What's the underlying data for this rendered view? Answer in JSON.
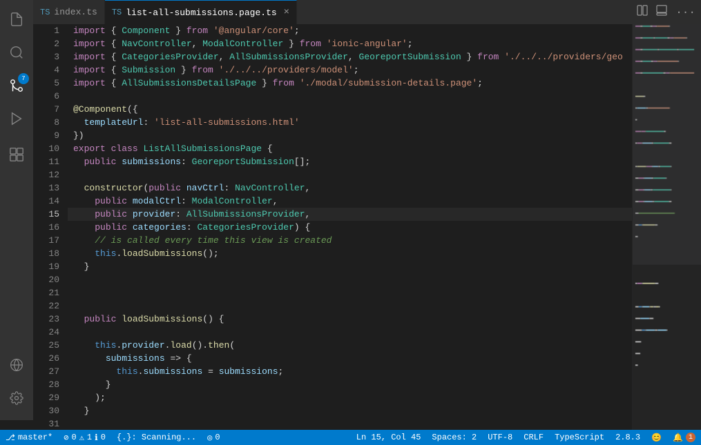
{
  "tabs": [
    {
      "id": "tab-index",
      "icon": "TS",
      "label": "index.ts",
      "active": false,
      "modified": false
    },
    {
      "id": "tab-list",
      "icon": "TS",
      "label": "list-all-submissions.page.ts",
      "active": true,
      "modified": false
    }
  ],
  "tabBarActions": [
    "copy-icon",
    "layout-icon",
    "more-icon"
  ],
  "lines": [
    {
      "num": 1,
      "tokens": [
        {
          "t": "kw",
          "v": "import"
        },
        {
          "t": "plain",
          "v": " { "
        },
        {
          "t": "cls",
          "v": "Component"
        },
        {
          "t": "plain",
          "v": " } "
        },
        {
          "t": "kw",
          "v": "from"
        },
        {
          "t": "plain",
          "v": " "
        },
        {
          "t": "str",
          "v": "'@angular/core'"
        },
        {
          "t": "plain",
          "v": ";"
        }
      ]
    },
    {
      "num": 2,
      "tokens": [
        {
          "t": "kw",
          "v": "import"
        },
        {
          "t": "plain",
          "v": " { "
        },
        {
          "t": "cls",
          "v": "NavController"
        },
        {
          "t": "plain",
          "v": ", "
        },
        {
          "t": "cls",
          "v": "ModalController"
        },
        {
          "t": "plain",
          "v": " } "
        },
        {
          "t": "kw",
          "v": "from"
        },
        {
          "t": "plain",
          "v": " "
        },
        {
          "t": "str",
          "v": "'ionic-angular'"
        },
        {
          "t": "plain",
          "v": ";"
        }
      ]
    },
    {
      "num": 3,
      "tokens": [
        {
          "t": "kw",
          "v": "import"
        },
        {
          "t": "plain",
          "v": " { "
        },
        {
          "t": "cls",
          "v": "CategoriesProvider"
        },
        {
          "t": "plain",
          "v": ", "
        },
        {
          "t": "cls",
          "v": "AllSubmissionsProvider"
        },
        {
          "t": "plain",
          "v": ", "
        },
        {
          "t": "cls",
          "v": "GeoreportSubmission"
        },
        {
          "t": "plain",
          "v": " } "
        },
        {
          "t": "kw",
          "v": "from"
        },
        {
          "t": "plain",
          "v": " "
        },
        {
          "t": "str",
          "v": "'./../../providers/geo"
        }
      ]
    },
    {
      "num": 4,
      "tokens": [
        {
          "t": "kw",
          "v": "import"
        },
        {
          "t": "plain",
          "v": " { "
        },
        {
          "t": "cls",
          "v": "Submission"
        },
        {
          "t": "plain",
          "v": " } "
        },
        {
          "t": "kw",
          "v": "from"
        },
        {
          "t": "plain",
          "v": " "
        },
        {
          "t": "str",
          "v": "'./../../providers/model'"
        },
        {
          "t": "plain",
          "v": ";"
        }
      ]
    },
    {
      "num": 5,
      "tokens": [
        {
          "t": "kw",
          "v": "import"
        },
        {
          "t": "plain",
          "v": " { "
        },
        {
          "t": "cls",
          "v": "AllSubmissionsDetailsPage"
        },
        {
          "t": "plain",
          "v": " } "
        },
        {
          "t": "kw",
          "v": "from"
        },
        {
          "t": "plain",
          "v": " "
        },
        {
          "t": "str",
          "v": "'./modal/submission-details.page'"
        },
        {
          "t": "plain",
          "v": ";"
        }
      ]
    },
    {
      "num": 6,
      "tokens": []
    },
    {
      "num": 7,
      "tokens": [
        {
          "t": "decorator",
          "v": "@Component"
        },
        {
          "t": "plain",
          "v": "({"
        }
      ]
    },
    {
      "num": 8,
      "tokens": [
        {
          "t": "plain",
          "v": "  "
        },
        {
          "t": "prop",
          "v": "templateUrl"
        },
        {
          "t": "plain",
          "v": ": "
        },
        {
          "t": "str",
          "v": "'list-all-submissions.html'"
        }
      ]
    },
    {
      "num": 9,
      "tokens": [
        {
          "t": "plain",
          "v": "})"
        }
      ]
    },
    {
      "num": 10,
      "tokens": [
        {
          "t": "kw",
          "v": "export"
        },
        {
          "t": "plain",
          "v": " "
        },
        {
          "t": "kw",
          "v": "class"
        },
        {
          "t": "plain",
          "v": " "
        },
        {
          "t": "cls",
          "v": "ListAllSubmissionsPage"
        },
        {
          "t": "plain",
          "v": " {"
        }
      ]
    },
    {
      "num": 11,
      "tokens": [
        {
          "t": "plain",
          "v": "  "
        },
        {
          "t": "kw",
          "v": "public"
        },
        {
          "t": "plain",
          "v": " "
        },
        {
          "t": "prop",
          "v": "submissions"
        },
        {
          "t": "plain",
          "v": ": "
        },
        {
          "t": "cls",
          "v": "GeoreportSubmission"
        },
        {
          "t": "plain",
          "v": "[];"
        }
      ]
    },
    {
      "num": 12,
      "tokens": []
    },
    {
      "num": 13,
      "tokens": [
        {
          "t": "plain",
          "v": "  "
        },
        {
          "t": "fn",
          "v": "constructor"
        },
        {
          "t": "plain",
          "v": "("
        },
        {
          "t": "kw",
          "v": "public"
        },
        {
          "t": "plain",
          "v": " "
        },
        {
          "t": "prop",
          "v": "navCtrl"
        },
        {
          "t": "plain",
          "v": ": "
        },
        {
          "t": "cls",
          "v": "NavController"
        },
        {
          "t": "plain",
          "v": ","
        }
      ]
    },
    {
      "num": 14,
      "tokens": [
        {
          "t": "plain",
          "v": "    "
        },
        {
          "t": "kw",
          "v": "public"
        },
        {
          "t": "plain",
          "v": " "
        },
        {
          "t": "prop",
          "v": "modalCtrl"
        },
        {
          "t": "plain",
          "v": ": "
        },
        {
          "t": "cls",
          "v": "ModalController"
        },
        {
          "t": "plain",
          "v": ","
        }
      ]
    },
    {
      "num": 15,
      "tokens": [
        {
          "t": "plain",
          "v": "    "
        },
        {
          "t": "kw",
          "v": "public"
        },
        {
          "t": "plain",
          "v": " "
        },
        {
          "t": "prop",
          "v": "provider"
        },
        {
          "t": "plain",
          "v": ": "
        },
        {
          "t": "cls",
          "v": "AllSubmissionsProvider"
        },
        {
          "t": "plain",
          "v": ","
        }
      ],
      "active": true
    },
    {
      "num": 16,
      "tokens": [
        {
          "t": "plain",
          "v": "    "
        },
        {
          "t": "kw",
          "v": "public"
        },
        {
          "t": "plain",
          "v": " "
        },
        {
          "t": "prop",
          "v": "categories"
        },
        {
          "t": "plain",
          "v": ": "
        },
        {
          "t": "cls",
          "v": "CategoriesProvider"
        },
        {
          "t": "plain",
          "v": ") {"
        }
      ]
    },
    {
      "num": 17,
      "tokens": [
        {
          "t": "plain",
          "v": "    "
        },
        {
          "t": "comment",
          "v": "// is called every time this view is created"
        }
      ]
    },
    {
      "num": 18,
      "tokens": [
        {
          "t": "plain",
          "v": "    "
        },
        {
          "t": "kw2",
          "v": "this"
        },
        {
          "t": "plain",
          "v": "."
        },
        {
          "t": "fn",
          "v": "loadSubmissions"
        },
        {
          "t": "plain",
          "v": "();"
        }
      ]
    },
    {
      "num": 19,
      "tokens": [
        {
          "t": "plain",
          "v": "  }"
        }
      ]
    },
    {
      "num": 20,
      "tokens": []
    },
    {
      "num": 21,
      "tokens": []
    },
    {
      "num": 22,
      "tokens": []
    },
    {
      "num": 23,
      "tokens": [
        {
          "t": "plain",
          "v": "  "
        },
        {
          "t": "kw",
          "v": "public"
        },
        {
          "t": "plain",
          "v": " "
        },
        {
          "t": "fn",
          "v": "loadSubmissions"
        },
        {
          "t": "plain",
          "v": "() {"
        }
      ]
    },
    {
      "num": 24,
      "tokens": []
    },
    {
      "num": 25,
      "tokens": [
        {
          "t": "plain",
          "v": "    "
        },
        {
          "t": "kw2",
          "v": "this"
        },
        {
          "t": "plain",
          "v": "."
        },
        {
          "t": "prop",
          "v": "provider"
        },
        {
          "t": "plain",
          "v": "."
        },
        {
          "t": "fn",
          "v": "load"
        },
        {
          "t": "plain",
          "v": "()."
        },
        {
          "t": "fn",
          "v": "then"
        },
        {
          "t": "plain",
          "v": "("
        }
      ]
    },
    {
      "num": 26,
      "tokens": [
        {
          "t": "plain",
          "v": "      "
        },
        {
          "t": "prop",
          "v": "submissions"
        },
        {
          "t": "plain",
          "v": " => {"
        }
      ]
    },
    {
      "num": 27,
      "tokens": [
        {
          "t": "plain",
          "v": "        "
        },
        {
          "t": "kw2",
          "v": "this"
        },
        {
          "t": "plain",
          "v": "."
        },
        {
          "t": "prop",
          "v": "submissions"
        },
        {
          "t": "plain",
          "v": " = "
        },
        {
          "t": "prop",
          "v": "submissions"
        },
        {
          "t": "plain",
          "v": ";"
        }
      ]
    },
    {
      "num": 28,
      "tokens": [
        {
          "t": "plain",
          "v": "      }"
        }
      ]
    },
    {
      "num": 29,
      "tokens": [
        {
          "t": "plain",
          "v": "    );"
        }
      ]
    },
    {
      "num": 30,
      "tokens": [
        {
          "t": "plain",
          "v": "  }"
        }
      ]
    },
    {
      "num": 31,
      "tokens": []
    }
  ],
  "status": {
    "branch": "master*",
    "errors": "0",
    "warnings": "1",
    "info": "0",
    "scanning": "{.}: Scanning...",
    "problems": "0",
    "cursor": "Ln 15, Col 45",
    "spaces": "Spaces: 2",
    "encoding": "UTF-8",
    "lineEnding": "CRLF",
    "language": "TypeScript",
    "version": "2.8.3",
    "smiley": "😊",
    "bell": "🔔"
  },
  "activityBar": {
    "icons": [
      {
        "id": "files-icon",
        "symbol": "⬜",
        "active": false
      },
      {
        "id": "search-icon",
        "symbol": "🔍",
        "active": false
      },
      {
        "id": "source-control-icon",
        "symbol": "⎇",
        "active": true,
        "badge": "7"
      },
      {
        "id": "debug-icon",
        "symbol": "▷",
        "active": false
      },
      {
        "id": "extensions-icon",
        "symbol": "⊞",
        "active": false
      }
    ],
    "bottom": [
      {
        "id": "remote-icon",
        "symbol": "⊙"
      },
      {
        "id": "settings-icon",
        "symbol": "⚙"
      }
    ]
  }
}
